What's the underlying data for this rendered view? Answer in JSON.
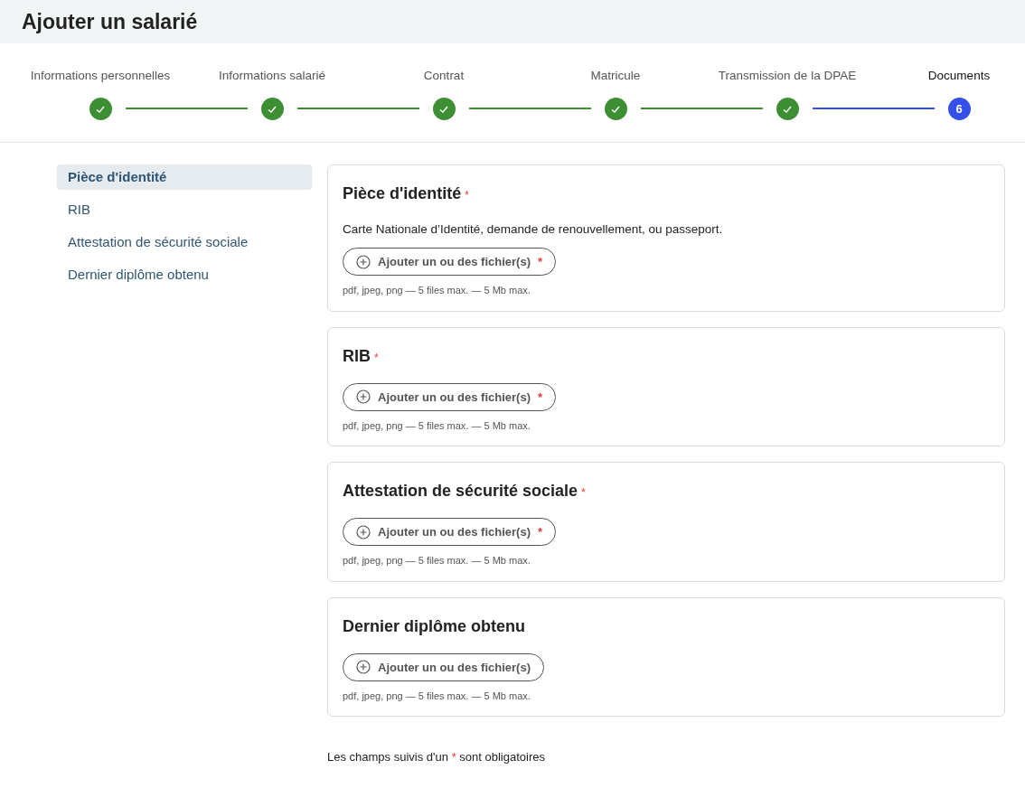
{
  "window": {
    "title": "Ajouter un salarié"
  },
  "steps": [
    {
      "label": "Informations personnelles",
      "completed": true,
      "selected": false
    },
    {
      "label": "Informations salarié",
      "completed": true,
      "selected": false
    },
    {
      "label": "Contrat",
      "completed": true,
      "selected": false
    },
    {
      "label": "Matricule",
      "completed": true,
      "selected": false
    },
    {
      "label": "Transmission de la DPAE",
      "completed": true,
      "selected": false
    },
    {
      "label": "Documents",
      "completed": false,
      "selected": true,
      "number": "6"
    }
  ],
  "sidebar": {
    "items": [
      {
        "label": "Pièce d'identité",
        "selected": true
      },
      {
        "label": "RIB",
        "selected": false
      },
      {
        "label": "Attestation de sécurité sociale",
        "selected": false
      },
      {
        "label": "Dernier diplôme obtenu",
        "selected": false
      }
    ]
  },
  "sections": [
    {
      "title": "Pièce d'identité",
      "required": true,
      "description": "Carte Nationale d’Identité, demande de renouvellement, ou passeport.",
      "button": "Ajouter un ou des fichier(s)",
      "hint": "pdf, jpeg, png — 5 files max. — 5 Mb max."
    },
    {
      "title": "RIB",
      "required": true,
      "button": "Ajouter un ou des fichier(s)",
      "hint": "pdf, jpeg, png — 5 files max. — 5 Mb max."
    },
    {
      "title": "Attestation de sécurité sociale",
      "required": true,
      "button": "Ajouter un ou des fichier(s)",
      "hint": "pdf, jpeg, png — 5 files max. — 5 Mb max."
    },
    {
      "title": "Dernier diplôme obtenu",
      "required": false,
      "button": "Ajouter un ou des fichier(s)",
      "hint": "pdf, jpeg, png — 5 files max. — 5 Mb max."
    }
  ],
  "footnote": {
    "before": "Les champs suivis d'un",
    "mark": "*",
    "after": "sont obligatoires"
  }
}
